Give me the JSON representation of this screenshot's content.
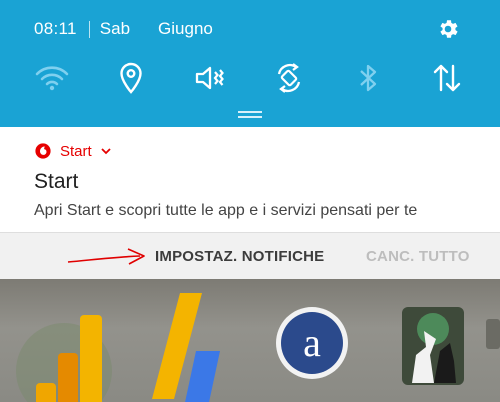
{
  "status_bar": {
    "time": "08:11",
    "day": "Sab",
    "month": "Giugno"
  },
  "quick_settings": {
    "background": "#1aa3d4",
    "toggles": [
      {
        "icon": "wifi-icon",
        "state": "off"
      },
      {
        "icon": "location-icon",
        "state": "on"
      },
      {
        "icon": "sound-off-icon",
        "state": "on"
      },
      {
        "icon": "auto-rotate-icon",
        "state": "on"
      },
      {
        "icon": "bluetooth-icon",
        "state": "off"
      },
      {
        "icon": "data-transfer-icon",
        "state": "on"
      }
    ],
    "settings_icon": "gear-icon"
  },
  "notification": {
    "app_icon": "vodafone-logo",
    "app_name": "Start",
    "title": "Start",
    "body": "Apri Start e scopri tutte le app e i servizi pensati per te",
    "accent": "#e60000",
    "actions": {
      "settings_label": "IMPOSTAZ. NOTIFICHE",
      "clear_label": "CANC. TUTTO"
    },
    "annotation_arrow_color": "#e00000"
  },
  "home_screen": {
    "apps": [
      {
        "name": "Google Analytics",
        "icon": "analytics-icon"
      },
      {
        "name": "AdSense",
        "icon": "adsense-icon"
      },
      {
        "name": "Alexa",
        "icon": "alexa-icon"
      },
      {
        "name": "Scacchi",
        "icon": "chess-icon"
      }
    ]
  }
}
